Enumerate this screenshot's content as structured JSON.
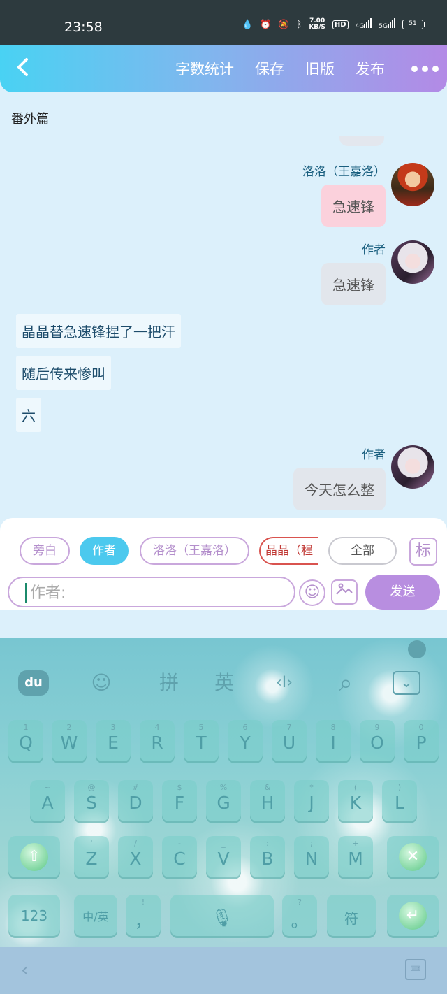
{
  "status_bar": {
    "time": "23:58",
    "speed_value": "7.00",
    "speed_unit": "KB/S",
    "hd": "HD",
    "net_4g": "4G",
    "net_5g": "5G",
    "battery": "51"
  },
  "header": {
    "back_icon": "chevron-left-icon",
    "word_count": "字数统计",
    "save": "保存",
    "old_version": "旧版",
    "publish": "发布",
    "more_icon": "more-dots-icon"
  },
  "chapter_title": "番外篇",
  "messages": [
    {
      "name": "洛洛（王嘉洛）",
      "text": "急速锋",
      "style": "pink"
    },
    {
      "name": "作者",
      "text": "急速锋",
      "style": "gray"
    },
    {
      "text": "晶晶替急速锋捏了一把汗"
    },
    {
      "text": "随后传来惨叫"
    },
    {
      "text": "六"
    },
    {
      "name": "作者",
      "text": "今天怎么整",
      "style": "gray"
    }
  ],
  "roles": {
    "narration": "旁白",
    "author": "作者",
    "luoluo": "洛洛（王嘉洛）",
    "jingjing": "晶晶（程",
    "all": "全部",
    "tag": "标"
  },
  "input": {
    "placeholder": "作者:",
    "send": "发送"
  },
  "keyboard": {
    "toolbar": {
      "logo": "du",
      "emoji": "☺",
      "pinyin": "拼",
      "english": "英",
      "cursor": "‹I›",
      "search": "⌕",
      "hide": "⌄"
    },
    "row1": [
      {
        "main": "Q",
        "sub": "1"
      },
      {
        "main": "W",
        "sub": "2"
      },
      {
        "main": "E",
        "sub": "3"
      },
      {
        "main": "R",
        "sub": "4"
      },
      {
        "main": "T",
        "sub": "5"
      },
      {
        "main": "Y",
        "sub": "6"
      },
      {
        "main": "U",
        "sub": "7"
      },
      {
        "main": "I",
        "sub": "8"
      },
      {
        "main": "O",
        "sub": "9"
      },
      {
        "main": "P",
        "sub": "0"
      }
    ],
    "row2": [
      {
        "main": "A",
        "sub": "~"
      },
      {
        "main": "S",
        "sub": "@"
      },
      {
        "main": "D",
        "sub": "#"
      },
      {
        "main": "F",
        "sub": "$"
      },
      {
        "main": "G",
        "sub": "%"
      },
      {
        "main": "H",
        "sub": "&"
      },
      {
        "main": "J",
        "sub": "*"
      },
      {
        "main": "K",
        "sub": "("
      },
      {
        "main": "L",
        "sub": ")"
      }
    ],
    "row3": [
      {
        "main": "Z",
        "sub": "'"
      },
      {
        "main": "X",
        "sub": "/"
      },
      {
        "main": "C",
        "sub": "-"
      },
      {
        "main": "V",
        "sub": "_"
      },
      {
        "main": "B",
        "sub": ":"
      },
      {
        "main": "N",
        "sub": ";"
      },
      {
        "main": "M",
        "sub": "+"
      }
    ],
    "num": "123",
    "lang": "中/英",
    "comma": "，",
    "comma_sub": "!",
    "period": "。",
    "period_sub": "?",
    "symbol": "符"
  }
}
